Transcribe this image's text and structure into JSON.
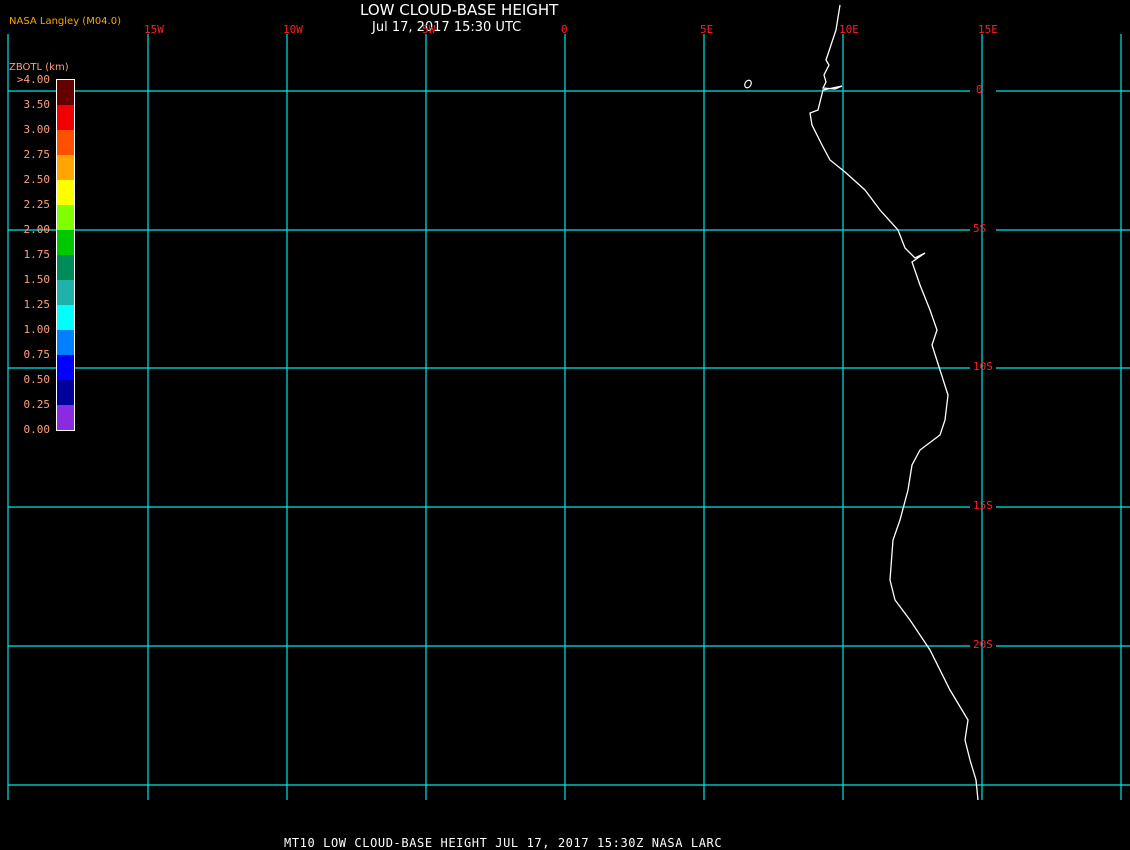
{
  "header": {
    "title": "LOW CLOUD-BASE HEIGHT",
    "datetime": "Jul 17, 2017 15:30 UTC",
    "credit": "NASA Langley (M04.0)"
  },
  "map": {
    "grid_color": "#00e5e5",
    "label_color": "#ff2020",
    "coastline_color": "#ffffff",
    "longitude_labels": [
      "15W",
      "10W",
      "5W",
      "0",
      "5E",
      "10E",
      "15E"
    ],
    "latitude_labels": [
      "0",
      "5S",
      "10S",
      "15S",
      "20S"
    ]
  },
  "legend": {
    "title": "ZBOTL (km)",
    "labels": [
      ">4.00",
      "3.50",
      "3.00",
      "2.75",
      "2.50",
      "2.25",
      "2.00",
      "1.75",
      "1.50",
      "1.25",
      "1.00",
      "0.75",
      "0.50",
      "0.25",
      "0.00"
    ],
    "colors": [
      "#640000",
      "#f00000",
      "#ff5000",
      "#ffa500",
      "#ffff00",
      "#80ff00",
      "#00c800",
      "#008c5a",
      "#20b2aa",
      "#00ffff",
      "#0080ff",
      "#0000ff",
      "#00009a",
      "#8a2be2"
    ]
  },
  "footer": {
    "text": "MT10  LOW CLOUD-BASE HEIGHT   JUL 17, 2017 15:30Z   NASA LARC"
  }
}
